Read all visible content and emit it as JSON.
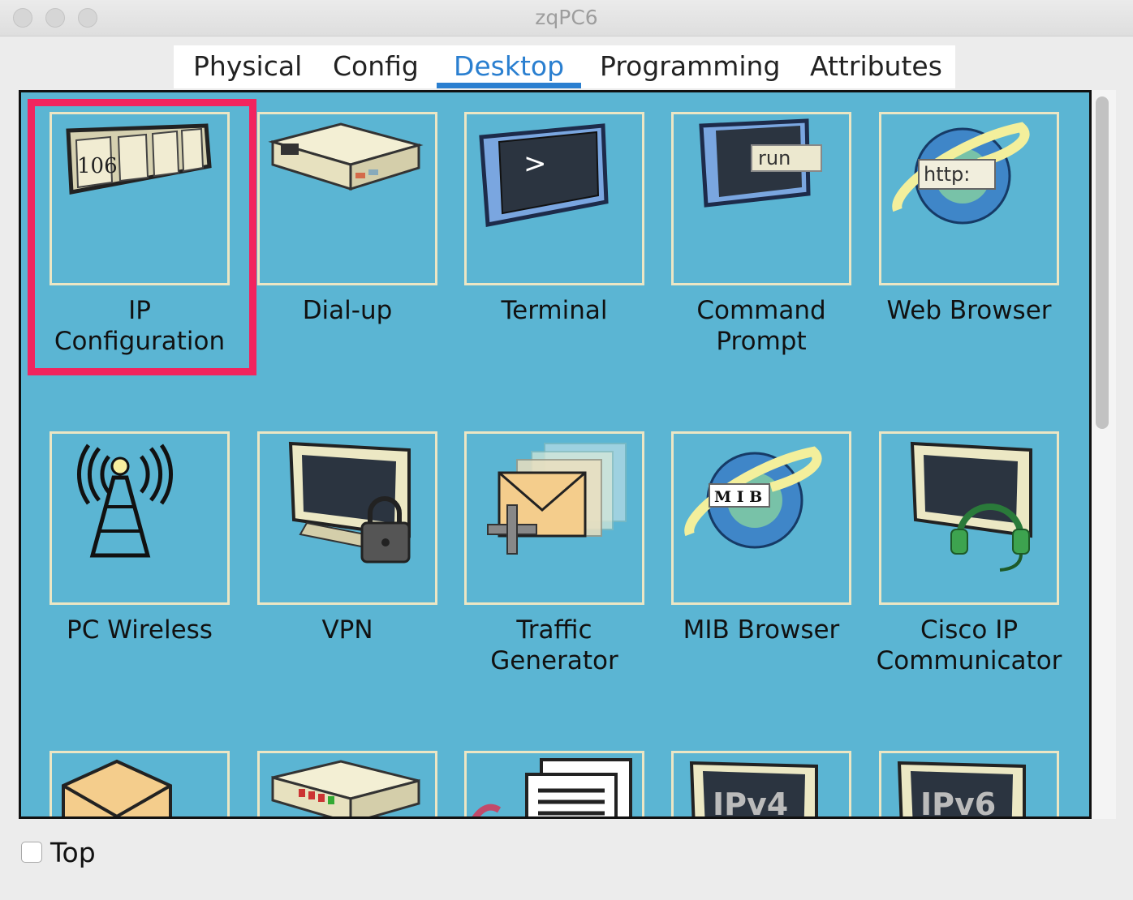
{
  "window": {
    "title": "zqPC6"
  },
  "tabs": [
    {
      "label": "Physical"
    },
    {
      "label": "Config"
    },
    {
      "label": "Desktop",
      "active": true
    },
    {
      "label": "Programming"
    },
    {
      "label": "Attributes"
    }
  ],
  "apps": [
    {
      "label": "IP\nConfiguration",
      "icon": "ip-config-icon",
      "badge": "106",
      "selected": true
    },
    {
      "label": "Dial-up",
      "icon": "modem-icon"
    },
    {
      "label": "Terminal",
      "icon": "terminal-icon",
      "badge": ">"
    },
    {
      "label": "Command\nPrompt",
      "icon": "command-prompt-icon",
      "badge": "run"
    },
    {
      "label": "Web Browser",
      "icon": "web-browser-icon",
      "badge": "http:"
    },
    {
      "label": "PC Wireless",
      "icon": "wireless-tower-icon"
    },
    {
      "label": "VPN",
      "icon": "vpn-lock-icon"
    },
    {
      "label": "Traffic\nGenerator",
      "icon": "traffic-generator-icon"
    },
    {
      "label": "MIB Browser",
      "icon": "mib-browser-icon",
      "badge": "M I B"
    },
    {
      "label": "Cisco IP\nCommunicator",
      "icon": "ip-communicator-icon"
    },
    {
      "label": "",
      "icon": "email-icon"
    },
    {
      "label": "",
      "icon": "pppoe-dialer-icon"
    },
    {
      "label": "",
      "icon": "text-editor-icon"
    },
    {
      "label": "",
      "icon": "ipv4-firewall-icon",
      "badge": "IPv4"
    },
    {
      "label": "",
      "icon": "ipv6-firewall-icon",
      "badge": "IPv6"
    }
  ],
  "footer": {
    "top_label": "Top",
    "top_checked": false
  },
  "colors": {
    "accent": "#2a7fd0",
    "panel_bg": "#5bb5d3",
    "highlight": "#f2245e"
  }
}
